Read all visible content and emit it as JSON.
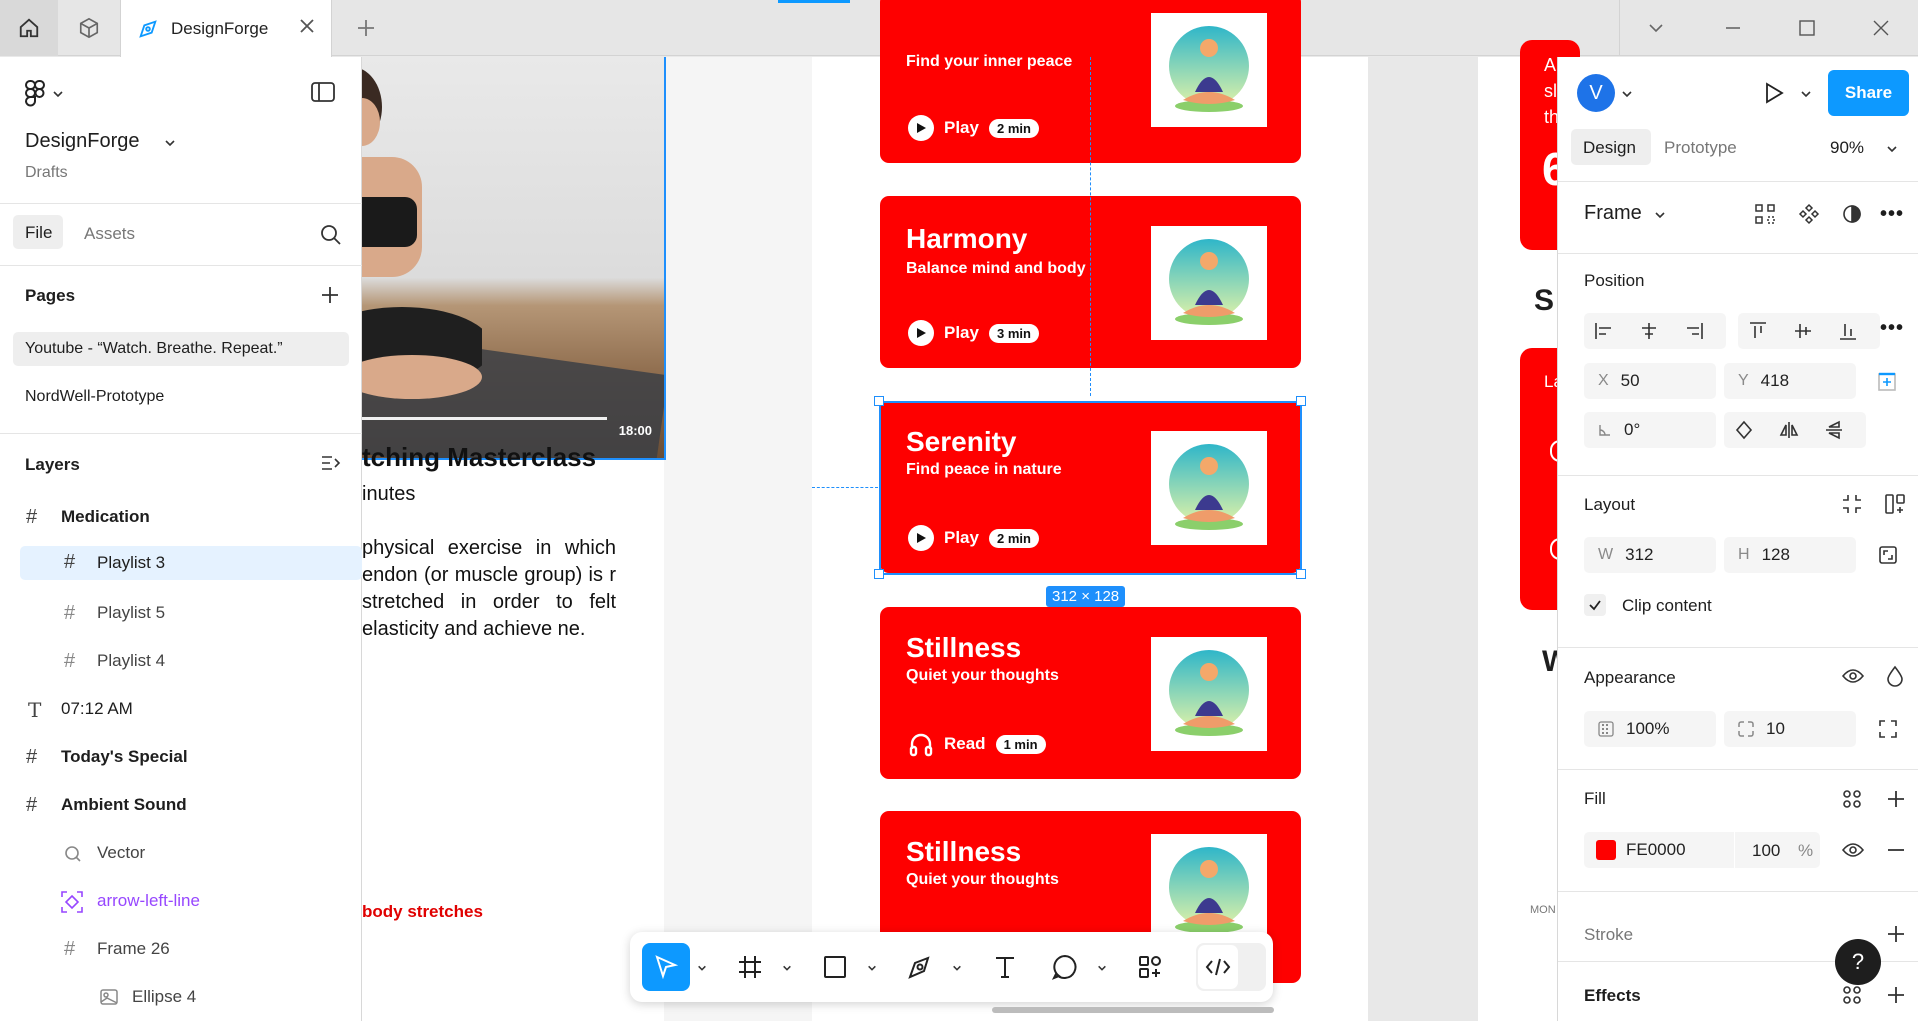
{
  "titlebar": {
    "tab_label": "DesignForge"
  },
  "canvas": {
    "video_time": "18:00",
    "article_title": "tching Masterclass",
    "article_sub": "inutes",
    "article_body": "physical exercise in which endon (or muscle group) is r stretched in order to felt elasticity and achieve ne.",
    "article_link": "body stretches",
    "cards": [
      {
        "title": "",
        "subtitle": "Find your inner peace",
        "action": "Play",
        "duration": "2 min"
      },
      {
        "title": "Harmony",
        "subtitle": "Balance mind and body",
        "action": "Play",
        "duration": "3 min"
      },
      {
        "title": "Serenity",
        "subtitle": "Find peace in nature",
        "action": "Play",
        "duration": "2 min"
      },
      {
        "title": "Stillness",
        "subtitle": "Quiet your thoughts",
        "action": "Read",
        "duration": "1 min"
      },
      {
        "title": "Stillness",
        "subtitle": "Quiet your thoughts",
        "action": "",
        "duration": ""
      }
    ],
    "dimension_badge": "312 × 128",
    "right_letters": {
      "a": "A",
      "sl": "sl",
      "th": "th",
      "six": "6",
      "s": "S",
      "la": "La",
      "w": "W",
      "mon": "MON"
    }
  },
  "left_panel": {
    "project_name": "DesignForge",
    "project_location": "Drafts",
    "tabs": {
      "file": "File",
      "assets": "Assets"
    },
    "pages_header": "Pages",
    "pages": [
      "Youtube - “Watch. Breathe. Repeat.”",
      "NordWell-Prototype"
    ],
    "layers_header": "Layers",
    "layers": [
      {
        "name": "Medication",
        "icon": "frame-icon"
      },
      {
        "name": "Playlist 3",
        "icon": "frame-icon"
      },
      {
        "name": "Playlist 5",
        "icon": "frame-icon"
      },
      {
        "name": "Playlist 4",
        "icon": "frame-icon"
      },
      {
        "name": "07:12 AM",
        "icon": "text-icon"
      },
      {
        "name": "Today's Special",
        "icon": "frame-icon"
      },
      {
        "name": "Ambient Sound",
        "icon": "frame-icon"
      },
      {
        "name": "Vector",
        "icon": "vector-icon"
      },
      {
        "name": "arrow-left-line",
        "icon": "component-icon"
      },
      {
        "name": "Frame 26",
        "icon": "frame-icon"
      },
      {
        "name": "Ellipse 4",
        "icon": "image-icon"
      }
    ]
  },
  "right_panel": {
    "avatar_letter": "V",
    "share_label": "Share",
    "tabs": {
      "design": "Design",
      "prototype": "Prototype"
    },
    "zoom": "90%",
    "frame_label": "Frame",
    "position_header": "Position",
    "x_label": "X",
    "x_value": "50",
    "y_label": "Y",
    "y_value": "418",
    "rotation_value": "0°",
    "layout_header": "Layout",
    "w_label": "W",
    "w_value": "312",
    "h_label": "H",
    "h_value": "128",
    "clip_content": "Clip content",
    "appearance_header": "Appearance",
    "opacity_value": "100%",
    "radius_value": "10",
    "fill_header": "Fill",
    "fill_hex": "FE0000",
    "fill_opacity": "100",
    "fill_pct": "%",
    "stroke_header": "Stroke",
    "effects_header": "Effects"
  },
  "help_label": "?",
  "colors": {
    "accent": "#0d99ff",
    "card_red": "#fe0000",
    "purple_layer": "#9747ff"
  }
}
